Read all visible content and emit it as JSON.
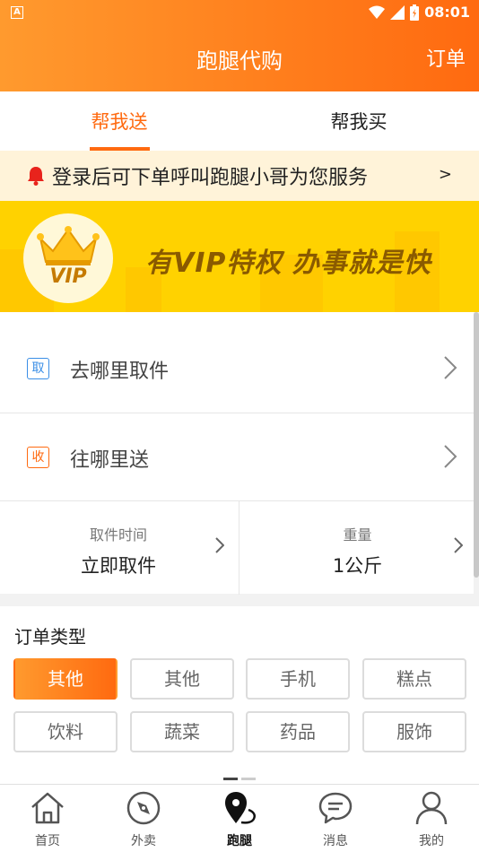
{
  "status_bar": {
    "app_icon_letter": "A",
    "time": "08:01"
  },
  "header": {
    "title": "跑腿代购",
    "orders_label": "订单"
  },
  "tabs": [
    {
      "label": "帮我送",
      "active": true
    },
    {
      "label": "帮我买",
      "active": false
    }
  ],
  "notice": {
    "text": "登录后可下单呼叫跑腿小哥为您服务",
    "arrow": ">"
  },
  "vip_banner": {
    "badge_text": "VIP",
    "slogan": "有VIP特权  办事就是快"
  },
  "addresses": [
    {
      "tag": "取",
      "label": "去哪里取件"
    },
    {
      "tag": "收",
      "label": "往哪里送"
    }
  ],
  "pickup_info": {
    "time_label": "取件时间",
    "time_value": "立即取件",
    "weight_label": "重量",
    "weight_value": "1公斤"
  },
  "order_types": {
    "title": "订单类型",
    "options": [
      "其他",
      "其他",
      "手机",
      "糕点",
      "饮料",
      "蔬菜",
      "药品",
      "服饰"
    ],
    "selected_index": 0
  },
  "bottom_nav": [
    {
      "label": "首页",
      "icon": "home-icon"
    },
    {
      "label": "外卖",
      "icon": "compass-icon"
    },
    {
      "label": "跑腿",
      "icon": "location-pin-icon",
      "active": true
    },
    {
      "label": "消息",
      "icon": "message-bubble-icon"
    },
    {
      "label": "我的",
      "icon": "person-icon"
    }
  ],
  "colors": {
    "accent": "#ff6a10",
    "accent_light": "#ff9a2e",
    "vip_yellow": "#ffd200",
    "notice_bg": "#fff3d9"
  }
}
